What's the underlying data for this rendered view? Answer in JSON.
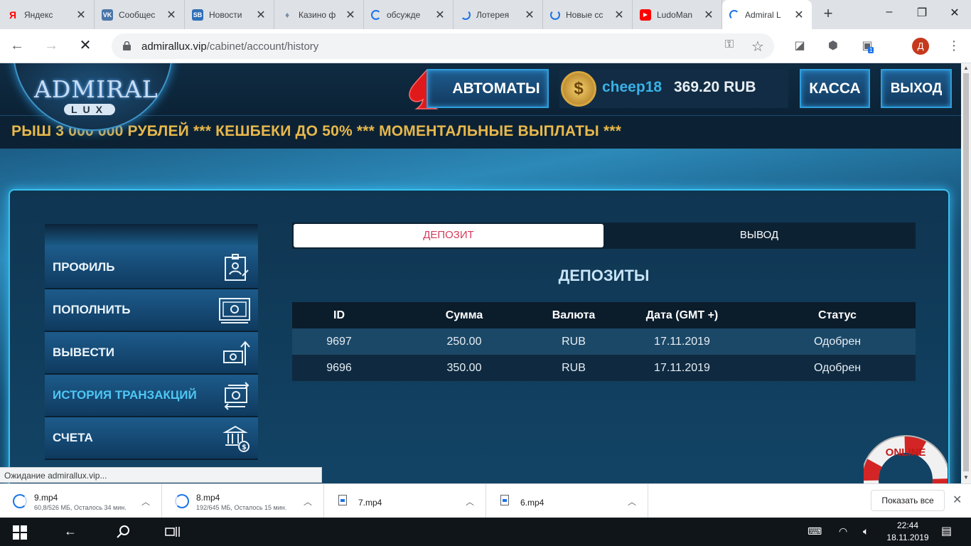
{
  "browser": {
    "tabs": [
      {
        "title": "Яндекс",
        "favicon": "yandex-icon",
        "color": "#ff0000",
        "glyph": "Я"
      },
      {
        "title": "Сообщес",
        "favicon": "vk-icon",
        "color": "#4a76a8",
        "glyph": "VK"
      },
      {
        "title": "Новости",
        "favicon": "sb-icon",
        "color": "#2f6fb7",
        "glyph": "SB"
      },
      {
        "title": "Казино ф",
        "favicon": "bulb-icon",
        "color": "#7a8ea6",
        "glyph": "♦"
      },
      {
        "title": "обсужде",
        "favicon": "loading-spinner-icon",
        "color": "#1a73e8",
        "glyph": ""
      },
      {
        "title": "Лотерея",
        "favicon": "loading-spinner-icon",
        "color": "#1a73e8",
        "glyph": ""
      },
      {
        "title": "Новые сс",
        "favicon": "loading-spinner-icon",
        "color": "#1a73e8",
        "glyph": ""
      },
      {
        "title": "LudoMan",
        "favicon": "youtube-icon",
        "color": "#ff0000",
        "glyph": "▶"
      },
      {
        "title": "Admiral L",
        "favicon": "loading-spinner-icon",
        "color": "#1a73e8",
        "glyph": "",
        "active": true
      }
    ],
    "url_host": "admirallux.vip",
    "url_path": "/cabinet/account/history",
    "profile_initial": "Д",
    "extension_badge": "1",
    "status_text": "Ожидание admirallux.vip..."
  },
  "site": {
    "logo_text": "ADMIRAL",
    "logo_sub": "LUX",
    "slots_button": "АВТОМАТЫ",
    "username": "cheep18",
    "balance": "369.20 RUB",
    "cashier_button": "КАССА",
    "logout_button": "ВЫХОД",
    "ticker": "РЫШ 3 000 000 РУБЛЕЙ   ***  КЕШБЕКИ ДО 50%   ***   МОМЕНТАЛЬНЫЕ ВЫПЛАТЫ   ***",
    "menu": [
      {
        "label": "ПРОФИЛЬ",
        "icon": "profile-card-icon"
      },
      {
        "label": "ПОПОЛНИТЬ",
        "icon": "banknotes-icon"
      },
      {
        "label": "ВЫВЕСТИ",
        "icon": "withdraw-icon"
      },
      {
        "label": "ИСТОРИЯ ТРАНЗАКЦИЙ",
        "icon": "transaction-history-icon",
        "active": true
      },
      {
        "label": "СЧЕТА",
        "icon": "bank-accounts-icon"
      }
    ],
    "tabs": {
      "deposit": "ДЕПОЗИТ",
      "withdraw": "ВЫВОД"
    },
    "section_title": "ДЕПОЗИТЫ",
    "table": {
      "headers": [
        "ID",
        "Сумма",
        "Валюта",
        "Дата (GMT +)",
        "Статус"
      ],
      "rows": [
        [
          "9697",
          "250.00",
          "RUB",
          "17.11.2019",
          "Одобрен"
        ],
        [
          "9696",
          "350.00",
          "RUB",
          "17.11.2019",
          "Одобрен"
        ]
      ]
    },
    "online_badge": "ONLINE"
  },
  "downloads": {
    "items": [
      {
        "name": "9.mp4",
        "status": "60,8/526 МБ, Осталось 34 мин.",
        "in_progress": true
      },
      {
        "name": "8.mp4",
        "status": "192/645 МБ, Осталось 15 мин.",
        "in_progress": true
      },
      {
        "name": "7.mp4",
        "status": "",
        "in_progress": false
      },
      {
        "name": "6.mp4",
        "status": "",
        "in_progress": false
      }
    ],
    "show_all": "Показать все"
  },
  "taskbar": {
    "time": "22:44",
    "date": "18.11.2019"
  }
}
